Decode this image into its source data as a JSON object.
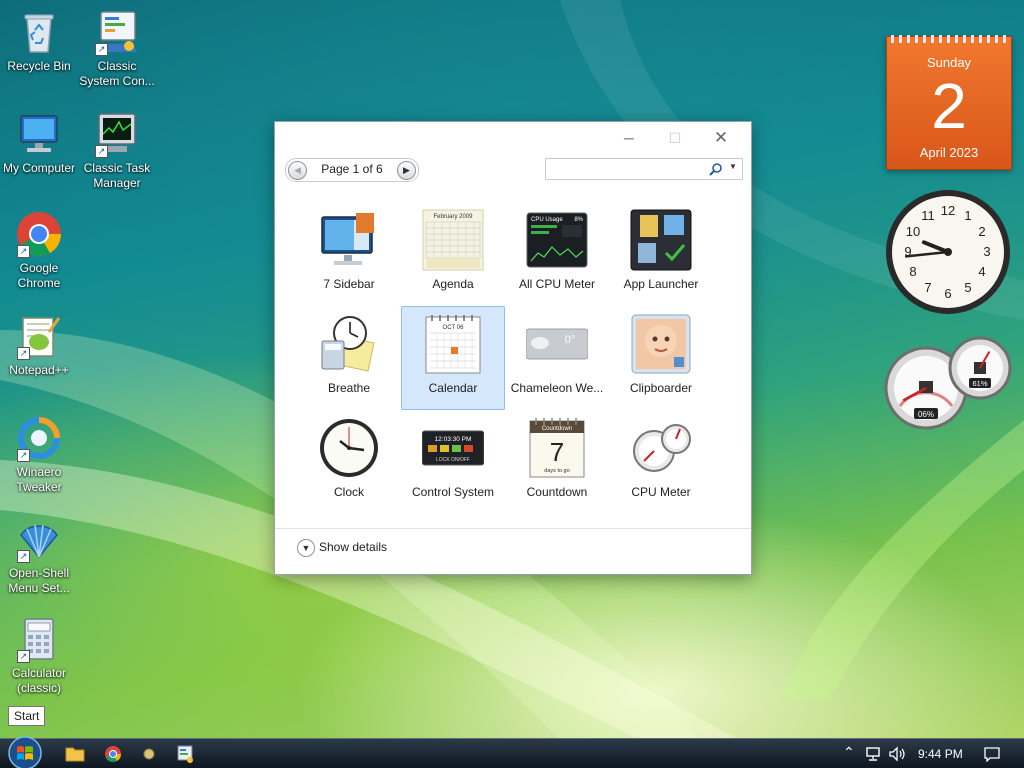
{
  "desktop": {
    "icons": [
      {
        "label": "Recycle Bin"
      },
      {
        "label": "Classic System Con..."
      },
      {
        "label": "My Computer"
      },
      {
        "label": "Classic Task Manager"
      },
      {
        "label": "Google Chrome"
      },
      {
        "label": "Notepad++"
      },
      {
        "label": "Winaero Tweaker"
      },
      {
        "label": "Open-Shell Menu Set..."
      },
      {
        "label": "Calculator (classic)"
      }
    ]
  },
  "gadget_window": {
    "pager_label": "Page 1 of 6",
    "search_value": "",
    "prev_icon": "chevron-left-icon",
    "next_icon": "chevron-right-icon",
    "search_icon": "search-icon",
    "gadgets": [
      {
        "name": "7 Sidebar",
        "icon": "monitor-icon",
        "selected": false
      },
      {
        "name": "Agenda",
        "icon": "agenda-calendar-icon",
        "selected": false
      },
      {
        "name": "All CPU Meter",
        "icon": "cpu-usage-icon",
        "selected": false
      },
      {
        "name": "App Launcher",
        "icon": "app-launcher-icon",
        "selected": false
      },
      {
        "name": "Breathe",
        "icon": "breathe-icon",
        "selected": false
      },
      {
        "name": "Calendar",
        "icon": "calendar-icon",
        "selected": true
      },
      {
        "name": "Chameleon We...",
        "icon": "weather-icon",
        "selected": false
      },
      {
        "name": "Clipboarder",
        "icon": "clipboarder-icon",
        "selected": false
      },
      {
        "name": "Clock",
        "icon": "clock-icon",
        "selected": false
      },
      {
        "name": "Control System",
        "icon": "control-system-icon",
        "selected": false
      },
      {
        "name": "Countdown",
        "icon": "countdown-icon",
        "selected": false
      },
      {
        "name": "CPU Meter",
        "icon": "cpu-meter-icon",
        "selected": false
      }
    ],
    "thumb_text": {
      "agenda_month": "February 2009",
      "cpu_title": "CPU Usage",
      "cpu_percent": "8%",
      "calendar_month": "OCT 06",
      "weather_temp": "0°",
      "control_time": "12:03:30 PM",
      "control_lock": "LOCK ON/OFF",
      "countdown_title": "Countdown",
      "countdown_number": "7",
      "countdown_sub": "days to go"
    },
    "details_label": "Show details"
  },
  "sidebar": {
    "calendar": {
      "weekday": "Sunday",
      "day": "2",
      "month_year": "April 2023"
    },
    "clock": {
      "hour": 9,
      "minute": 44
    },
    "cpu_meter": {
      "cpu_percent": "06%",
      "memory_percent": "61%",
      "cpu_value": 6,
      "memory_value": 61
    }
  },
  "taskbar": {
    "start_tooltip": "Start",
    "clock_time": "9:44 PM"
  },
  "colors": {
    "calendar_orange": "#e8692a",
    "selection_blue": "#d5e7fb"
  }
}
